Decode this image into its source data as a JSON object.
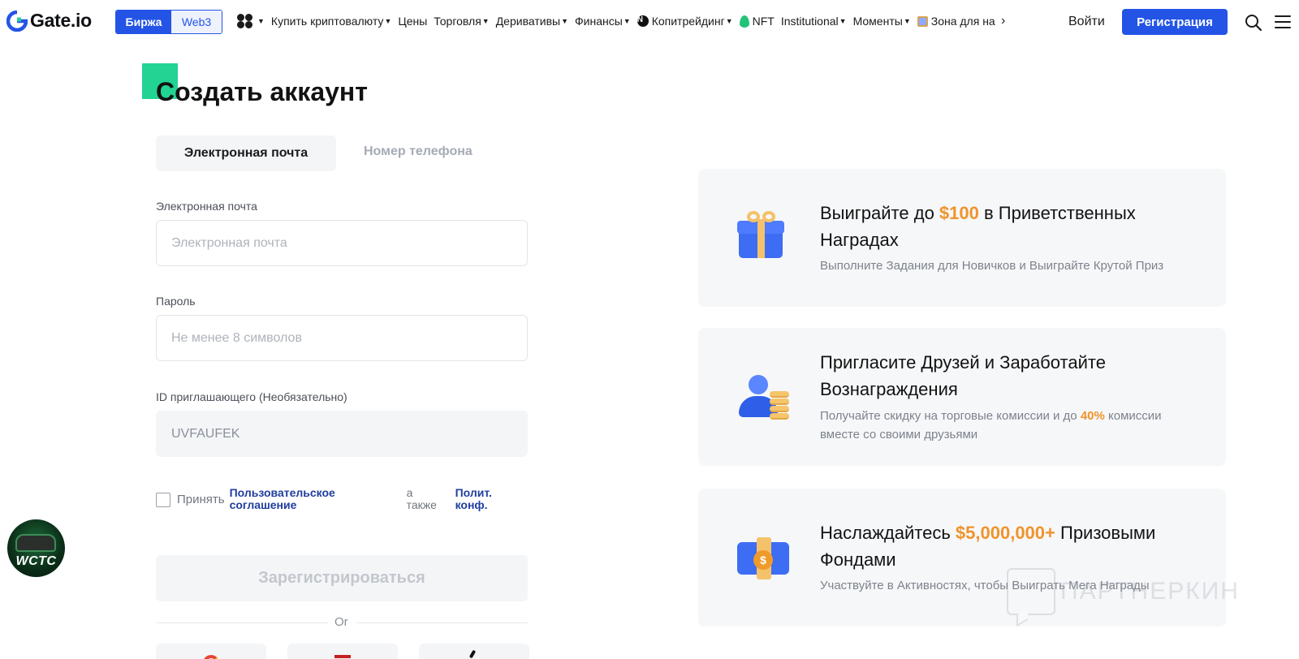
{
  "header": {
    "logo_text": "Gate.io",
    "switch": {
      "active": "Биржа",
      "inactive": "Web3"
    },
    "menu": [
      {
        "label": "Купить криптовалюту",
        "icon": "apps-icon",
        "dropdown": true
      },
      {
        "label": "Цены",
        "dropdown": false
      },
      {
        "label": "Торговля",
        "dropdown": true
      },
      {
        "label": "Деривативы",
        "dropdown": true
      },
      {
        "label": "Финансы",
        "dropdown": true
      },
      {
        "label": "Копитрейдинг",
        "icon": "n-badge-icon",
        "dropdown": true
      },
      {
        "label": "NFT",
        "icon": "leaf-icon",
        "dropdown": false
      },
      {
        "label": "Institutional",
        "dropdown": true
      },
      {
        "label": "Моменты",
        "dropdown": true
      },
      {
        "label": "Зона для на",
        "icon": "gift-icon",
        "dropdown": false
      }
    ],
    "more_glyph": "›",
    "login": "Войти",
    "register": "Регистрация",
    "n_badge": "N"
  },
  "form": {
    "title": "Создать аккаунт",
    "tabs": {
      "email": "Электронная почта",
      "phone": "Номер телефона"
    },
    "email_label": "Электронная почта",
    "email_placeholder": "Электронная почта",
    "password_label": "Пароль",
    "password_placeholder": "Не менее 8 символов",
    "referral_label": "ID приглашающего (Необязательно)",
    "referral_value": "UVFAUFEK",
    "agree": {
      "accept": "Принять",
      "terms_line1": "Пользовательское",
      "terms_line2": "соглашение",
      "also_line1": "а",
      "also_line2": "также",
      "policy_line1": "Полит.",
      "policy_line2": "конф."
    },
    "submit": "Зарегистрироваться",
    "or": "Or"
  },
  "badge_text": "WCTC",
  "cards": [
    {
      "title_pre": "Выиграйте до ",
      "title_hl": "$100",
      "title_post": " в Приветственных Наградах",
      "desc_pre": "Выполните Задания для Новичков и Выиграйте Крутой Приз",
      "desc_hl": "",
      "desc_post": "",
      "icon": "gift-icon"
    },
    {
      "title_pre": "Пригласите Друзей и Заработайте Вознаграждения",
      "title_hl": "",
      "title_post": "",
      "desc_pre": "Получайте скидку на торговые комиссии и до ",
      "desc_hl": "40%",
      "desc_post": " комиссии вместе со своими друзьями",
      "icon": "friends-icon"
    },
    {
      "title_pre": "Наслаждайтесь ",
      "title_hl": "$5,000,000+",
      "title_post": " Призовыми Фондами",
      "desc_pre": "Участвуйте в Активностях, чтобы Выиграть Мега Награды",
      "desc_hl": "",
      "desc_post": "",
      "icon": "cash-icon",
      "dollar": "$"
    }
  ],
  "watermark": "ПАРТНЕРКИН",
  "colors": {
    "accent": "#2354e6",
    "highlight": "#f0932b",
    "brand_green": "#22d394"
  }
}
